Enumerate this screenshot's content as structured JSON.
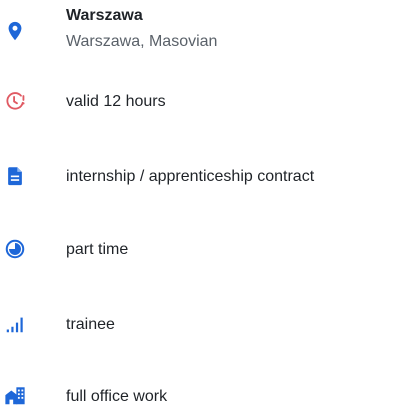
{
  "colors": {
    "primary_blue": "#1e67d8",
    "clock_red": "#e05a63",
    "text": "#1f2328",
    "muted_text": "#5a6169"
  },
  "items": [
    {
      "icon": "location-pin-icon",
      "title": "Warszawa",
      "subtitle": "Warszawa, Masovian"
    },
    {
      "icon": "clock-alert-icon",
      "label": "valid 12 hours"
    },
    {
      "icon": "document-icon",
      "label": "internship / apprenticeship contract"
    },
    {
      "icon": "pie-clock-icon",
      "label": "part time"
    },
    {
      "icon": "signal-bars-icon",
      "label": "trainee"
    },
    {
      "icon": "office-building-icon",
      "label": "full office work"
    }
  ]
}
